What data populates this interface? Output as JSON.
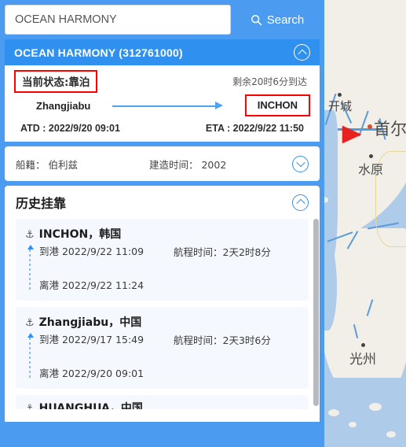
{
  "search": {
    "value": "OCEAN HARMONY",
    "placeholder": "OCEAN HARMONY",
    "button_label": "Search",
    "icon": "search-icon"
  },
  "vessel": {
    "title": "OCEAN HARMONY (312761000)",
    "collapse_icon": "chevron-up-icon",
    "status_label": "当前状态:靠泊",
    "remaining": "剩余20时6分到达",
    "port_from": "Zhangjiabu",
    "port_to": "INCHON",
    "atd": "ATD : 2022/9/20 09:01",
    "eta": "ETA : 2022/9/22 11:50",
    "flag": "船籍： 伯利兹",
    "built": "建造时间： 2002",
    "expand_icon": "chevron-down-icon"
  },
  "history": {
    "title": "历史挂靠",
    "collapse_icon": "chevron-up-icon",
    "entries": [
      {
        "port": "INCHON，韩国",
        "arrive": "到港 2022/9/22 11:09",
        "depart": "离港 2022/9/22 11:24",
        "duration": "航程时间：2天2时8分",
        "icon": "anchor-icon"
      },
      {
        "port": "Zhangjiabu，中国",
        "arrive": "到港 2022/9/17 15:49",
        "depart": "离港 2022/9/20 09:01",
        "duration": "航程时间：2天3时6分",
        "icon": "anchor-icon"
      },
      {
        "port": "HUANGHUA，中国",
        "arrive": "",
        "depart": "",
        "duration": "",
        "icon": "anchor-icon"
      }
    ]
  },
  "map": {
    "cities": [
      {
        "name": "开城",
        "capital": false
      },
      {
        "name": "首尔",
        "capital": true
      },
      {
        "name": "水原",
        "capital": false
      },
      {
        "name": "光州",
        "capital": false
      }
    ],
    "vessel_marker": "vessel-arrow-marker"
  },
  "colors": {
    "accent_blue": "#4b9bf0",
    "title_blue": "#2f90ef",
    "highlight_red": "#ff0000",
    "sea_blue": "#aecbea",
    "land_beige": "#f2efe8"
  }
}
